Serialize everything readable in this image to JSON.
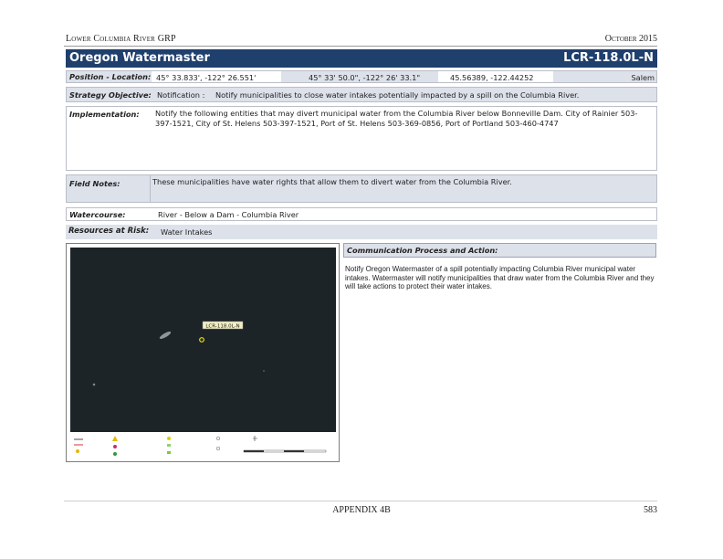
{
  "header": {
    "left": "Lower Columbia River GRP",
    "right": "October 2015"
  },
  "title": {
    "name": "Oregon Watermaster",
    "code": "LCR-118.0L-N"
  },
  "position": {
    "label": "Position - Location:",
    "ddm": "45° 33.833', -122° 26.551'",
    "dms": "45° 33' 50.0\", -122° 26' 33.1\"",
    "dd": "45.56389, -122.44252",
    "place": "Salem"
  },
  "strategy": {
    "label": "Strategy Objective:",
    "type": "Notification :",
    "text": "Notify municipalities to close water intakes potentially impacted by a spill on the Columbia River."
  },
  "implementation": {
    "label": "Implementation:",
    "text": "Notify the following entities that may divert municipal water from the Columbia River below Bonneville Dam. City of Rainier 503-397-1521, City of St. Helens 503-397-1521, Port of St. Helens 503-369-0856, Port of Portland 503-460-4747"
  },
  "field_notes": {
    "label": "Field Notes:",
    "text": "These municipalities have water rights that allow them to divert water from the Columbia River."
  },
  "watercourse": {
    "label": "Watercourse:",
    "text": "River - Below a Dam - Columbia River"
  },
  "resources": {
    "label": "Resources at Risk:",
    "text": "Water Intakes"
  },
  "communication": {
    "label": "Communication Process and Action:",
    "text": "Notify Oregon Watermaster of a spill potentially impacting Columbia River municipal water intakes.  Watermaster will notify municipalities that draw water from the Columbia River and they will take actions to protect their water intakes."
  },
  "map": {
    "site_label": "LCR-118.0L-N",
    "colors": {
      "background": "#1c2428",
      "marker": "#f2e600",
      "label_bg": "#f4efc2"
    }
  },
  "footer": {
    "center": "APPENDIX 4B",
    "page": "583"
  }
}
